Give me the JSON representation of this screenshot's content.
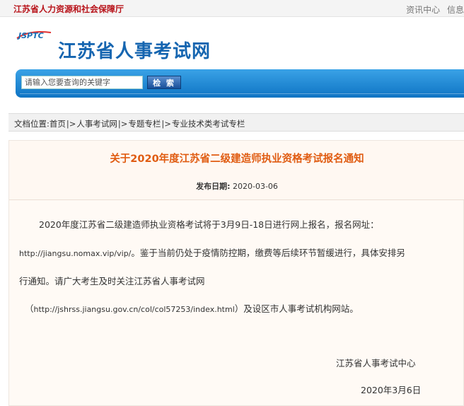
{
  "topbar": {
    "org_name": "江苏省人力资源和社会保障厅",
    "nav": [
      "资讯中心",
      "信息"
    ]
  },
  "header": {
    "logo_abbr": "JSPTC",
    "site_name": "江苏省人事考试网"
  },
  "search": {
    "placeholder": "请输入您要查询的关键字",
    "button_label": "检 索"
  },
  "breadcrumb": {
    "prefix": "文档位置:",
    "items": [
      "首页",
      "人事考试网",
      "专题专栏",
      "专业技术类考试专栏"
    ],
    "separator": "|>"
  },
  "article": {
    "title": "关于2020年度江苏省二级建造师执业资格考试报名通知",
    "date_label": "发布日期:",
    "date_value": "2020-03-06",
    "para1": "2020年度江苏省二级建造师执业资格考试将于3月9日-18日进行网上报名，报名网址：",
    "para2_link": "http://jiangsu.nomax.vip/vip/",
    "para2_text": "。鉴于当前仍处于疫情防控期，缴费等后续环节暂缓进行，具体安排另",
    "para3": "行通知。请广大考生及时关注江苏省人事考试网",
    "para4_open": "（",
    "para4_link": "http://jshrss.jiangsu.gov.cn/col/col57253/index.html",
    "para4_text": "）及设区市人事考试机构网站。",
    "signature_org": "江苏省人事考试中心",
    "signature_date": "2020年3月6日"
  }
}
